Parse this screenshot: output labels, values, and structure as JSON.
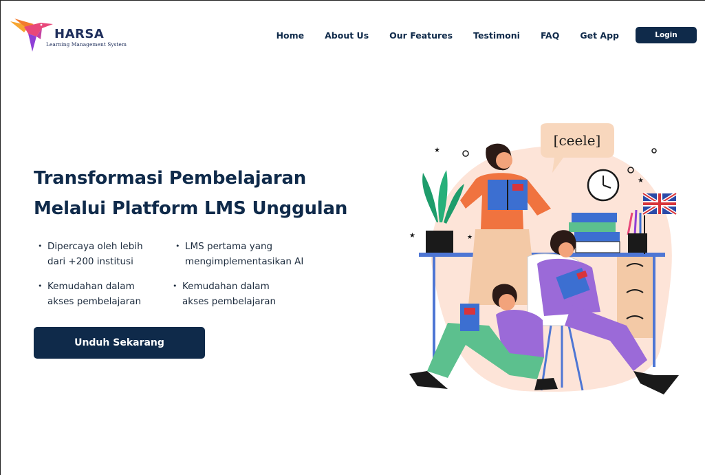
{
  "brand": {
    "name": "HARSA",
    "tagline": "Learning Management System"
  },
  "nav": {
    "items": [
      "Home",
      "About Us",
      "Our Features",
      "Testimoni",
      "FAQ",
      "Get App"
    ],
    "login_label": "Login"
  },
  "hero": {
    "title_line1": "Transformasi Pembelajaran",
    "title_line2": "Melalui Platform LMS Unggulan",
    "points": [
      {
        "line1": "Dipercaya oleh lebih",
        "line2": "dari +200 institusi"
      },
      {
        "line1": "LMS pertama yang",
        "line2": "mengimplementasikan AI"
      },
      {
        "line1": "Kemudahan dalam",
        "line2": "akses pembelajaran"
      },
      {
        "line1": "Kemudahan dalam",
        "line2": "akses pembelajaran"
      }
    ],
    "bullet": "•",
    "cta_label": "Unduh Sekarang"
  },
  "illustration": {
    "speech_bubble": "[ceele]",
    "icons": [
      "hummingbird-logo-icon",
      "people-reading-illustration",
      "clock-icon",
      "uk-flag-icon",
      "plant-icon",
      "books-icon",
      "pencil-cup-icon"
    ]
  },
  "colors": {
    "navy": "#0f2a4a",
    "blob": "#fde4d8",
    "green": "#5cc08e",
    "purple": "#9b6ad8",
    "orange": "#f0733f",
    "blue": "#3c6fd1"
  }
}
